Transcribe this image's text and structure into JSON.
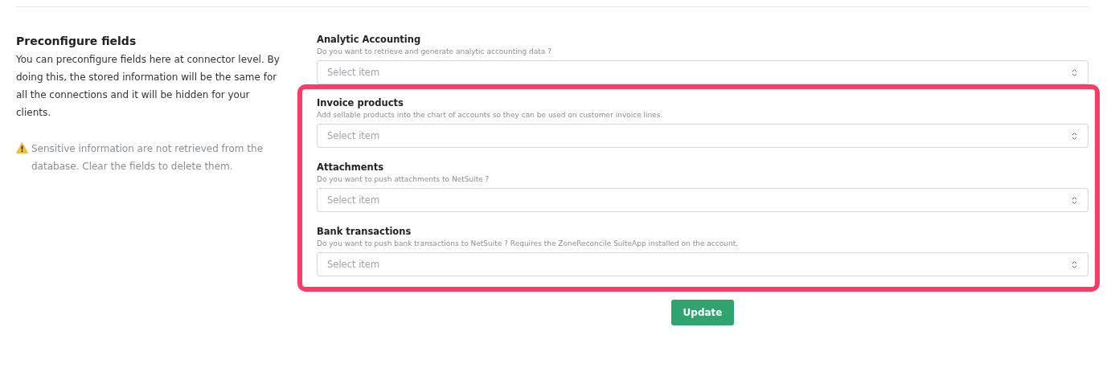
{
  "section": {
    "title": "Preconfigure fields",
    "description": "You can preconfigure fields here at connector level. By doing this, the stored information will be the same for all the connections and it will be hidden for your clients.",
    "warning": "Sensitive information are not retrieved from the database. Clear the fields to delete them."
  },
  "fields": [
    {
      "label": "Analytic Accounting",
      "hint": "Do you want to retrieve and generate analytic accounting data ?",
      "placeholder": "Select item",
      "highlighted": false
    },
    {
      "label": "Invoice products",
      "hint": "Add sellable products into the chart of accounts so they can be used on customer invoice lines.",
      "placeholder": "Select item",
      "highlighted": true
    },
    {
      "label": "Attachments",
      "hint": "Do you want to push attachments to NetSuite ?",
      "placeholder": "Select item",
      "highlighted": true
    },
    {
      "label": "Bank transactions",
      "hint": "Do you want to push bank transactions to NetSuite ? Requires the ZoneReconcile SuiteApp installed on the account.",
      "placeholder": "Select item",
      "highlighted": true
    }
  ],
  "button": "Update"
}
